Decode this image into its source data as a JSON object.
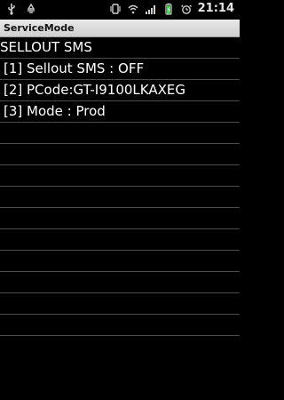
{
  "status_bar": {
    "time": "21:14",
    "left_icons": [
      "usb-icon",
      "recycle-icon"
    ],
    "right_icons": [
      "vibrate-icon",
      "wifi-icon",
      "signal-icon",
      "battery-icon",
      "alarm-icon"
    ],
    "battery_color": "#39d34a"
  },
  "titlebar": {
    "title": "ServiceMode"
  },
  "rows": [
    {
      "text": "SELLOUT SMS"
    },
    {
      "text": "[1] Sellout SMS : OFF"
    },
    {
      "text": "[2] PCode:GT-I9100LKAXEG"
    },
    {
      "text": "[3] Mode : Prod"
    },
    {
      "text": ""
    },
    {
      "text": ""
    },
    {
      "text": ""
    },
    {
      "text": ""
    },
    {
      "text": ""
    },
    {
      "text": ""
    },
    {
      "text": ""
    },
    {
      "text": ""
    },
    {
      "text": ""
    },
    {
      "text": ""
    }
  ]
}
